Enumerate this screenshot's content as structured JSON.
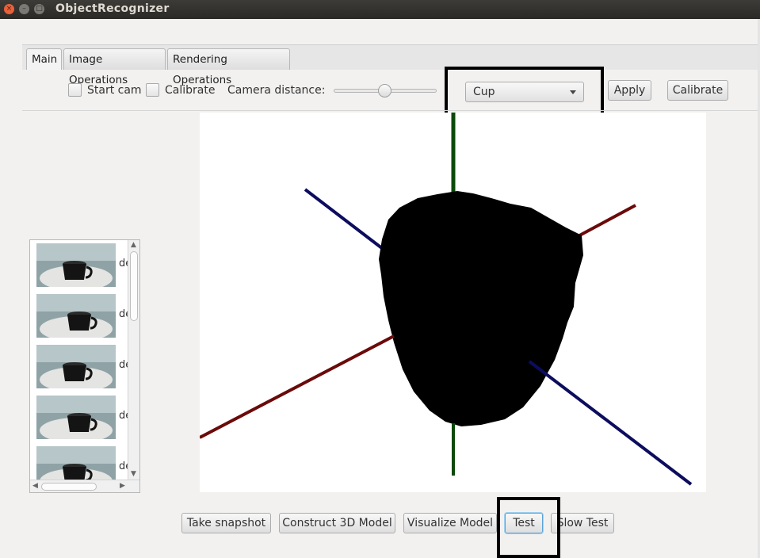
{
  "window": {
    "title": "ObjectRecognizer",
    "close_glyph": "×",
    "minimize_glyph": "–",
    "maximize_glyph": "□"
  },
  "tabs": [
    {
      "label": "Main",
      "selected": true
    },
    {
      "label": "Image Operations",
      "selected": false
    },
    {
      "label": "Rendering Operations",
      "selected": false
    }
  ],
  "toolbar": {
    "start_cam_label": "Start cam",
    "start_cam_checked": false,
    "calibrate_check_label": "Calibrate",
    "calibrate_checked": false,
    "camera_distance_label": "Camera distance:",
    "camera_distance_value_fraction": 0.5,
    "object_select_value": "Cup",
    "apply_label": "Apply",
    "calibrate_button_label": "Calibrate"
  },
  "image_list": {
    "items": [
      {
        "label": "de",
        "icon": "cup-photo"
      },
      {
        "label": "de",
        "icon": "cup-photo"
      },
      {
        "label": "de",
        "icon": "cup-photo"
      },
      {
        "label": "de",
        "icon": "cup-photo"
      },
      {
        "label": "de",
        "icon": "cup-photo"
      }
    ]
  },
  "viewer": {
    "axis_colors": {
      "x": "#6b0a0a",
      "y": "#0b4a0b",
      "z": "#0d0d5e"
    },
    "model_color": "#000000"
  },
  "bottom_buttons": {
    "take_snapshot": "Take snapshot",
    "construct_3d": "Construct 3D Model",
    "visualize": "Visualize Model",
    "test": "Test",
    "slow_test": "Slow Test"
  },
  "colors": {
    "titlebar": "#2b2a27",
    "close_button": "#e8613a",
    "focus_ring": "#5aa3d6",
    "annotation_box": "#000000"
  }
}
